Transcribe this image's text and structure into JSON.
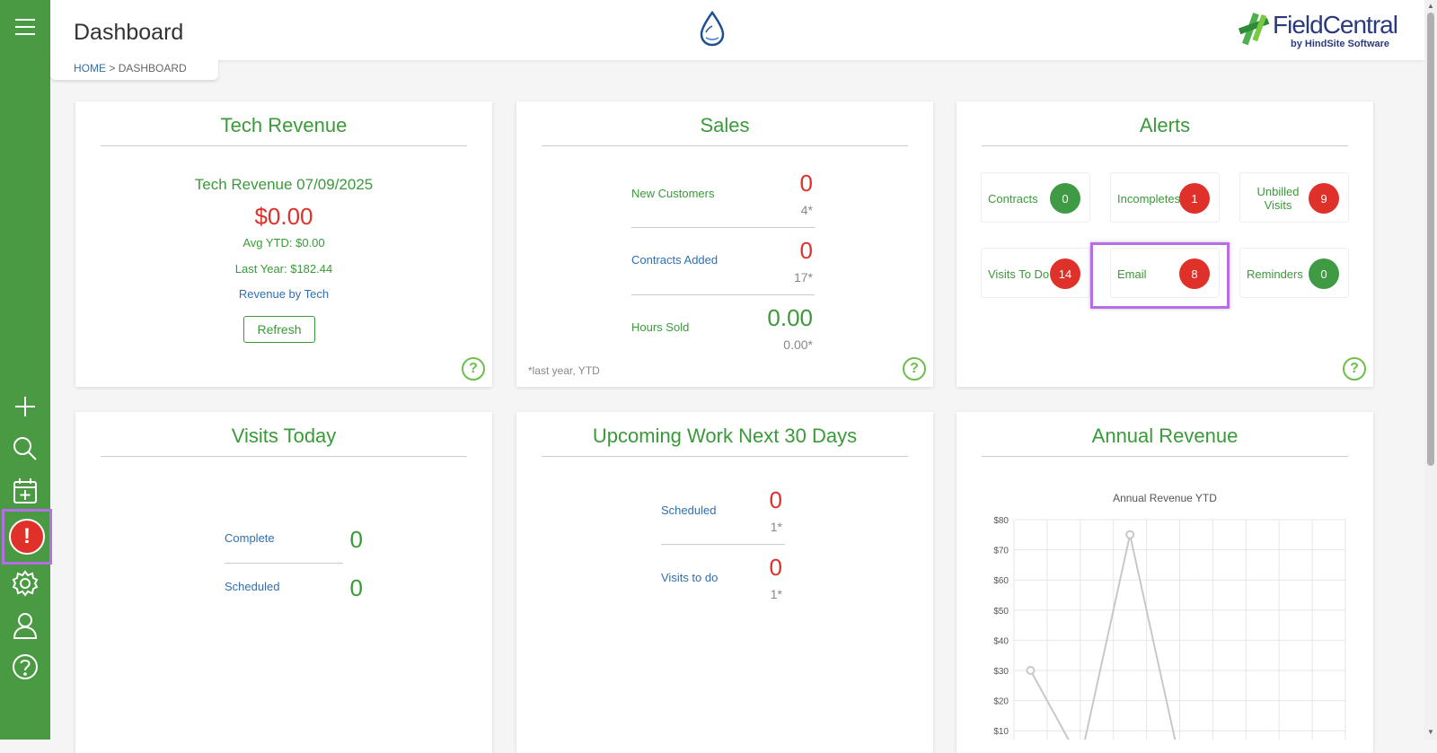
{
  "header": {
    "title": "Dashboard",
    "breadcrumb": {
      "home": "HOME",
      "separator": " > ",
      "current": "DASHBOARD"
    },
    "brand": {
      "name": "FieldCentral",
      "tagline": "by HindSite Software"
    }
  },
  "sidebar": {
    "icons": [
      "menu-icon",
      "plus-icon",
      "search-icon",
      "calendar-add-icon",
      "alert-icon",
      "gear-icon",
      "user-icon",
      "help-icon"
    ],
    "alert_glyph": "!",
    "accent": "#4a9a44"
  },
  "tech_revenue": {
    "title": "Tech Revenue",
    "subtitle": "Tech Revenue 07/09/2025",
    "amount": "$0.00",
    "avg_ytd": "Avg YTD: $0.00",
    "last_year": "Last Year: $182.44",
    "link": "Revenue by Tech",
    "refresh": "Refresh"
  },
  "sales": {
    "title": "Sales",
    "rows": [
      {
        "label": "New Customers",
        "value": "0",
        "prior": "4*"
      },
      {
        "label": "Contracts Added",
        "value": "0",
        "prior": "17*"
      },
      {
        "label": "Hours Sold",
        "value": "0.00",
        "prior": "0.00*"
      }
    ],
    "footnote": "*last year, YTD"
  },
  "alerts": {
    "title": "Alerts",
    "items": [
      {
        "label": "Contracts",
        "count": "0"
      },
      {
        "label": "Incompletes",
        "count": "1"
      },
      {
        "label": "Unbilled Visits",
        "count": "9"
      },
      {
        "label": "Visits To Do",
        "count": "14"
      },
      {
        "label": "Email",
        "count": "8"
      },
      {
        "label": "Reminders",
        "count": "0"
      }
    ]
  },
  "visits_today": {
    "title": "Visits Today",
    "rows": [
      {
        "label": "Complete",
        "value": "0"
      },
      {
        "label": "Scheduled",
        "value": "0"
      }
    ]
  },
  "upcoming": {
    "title": "Upcoming Work Next 30 Days",
    "rows": [
      {
        "label": "Scheduled",
        "value": "0",
        "prior": "1*"
      },
      {
        "label": "Visits to do",
        "value": "0",
        "prior": "1*"
      }
    ]
  },
  "annual_revenue": {
    "title": "Annual Revenue",
    "chart_data": {
      "type": "line",
      "title": "Annual Revenue YTD",
      "ytick_labels": [
        "$80",
        "$70",
        "$60",
        "$50",
        "$40",
        "$30",
        "$20",
        "$10"
      ],
      "ylim": [
        0,
        80
      ],
      "grid": true,
      "series": [
        {
          "values": [
            30,
            0,
            75,
            0
          ]
        }
      ]
    }
  },
  "help_glyph": "?"
}
